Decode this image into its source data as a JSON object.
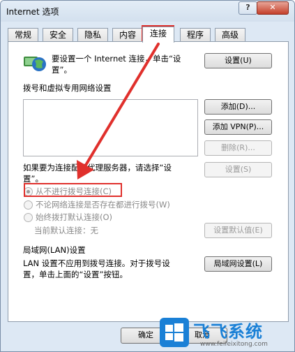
{
  "window": {
    "title": "Internet 选项",
    "help_label": "?",
    "close_label": "✕"
  },
  "tabs": [
    {
      "label": "常规"
    },
    {
      "label": "安全"
    },
    {
      "label": "隐私"
    },
    {
      "label": "内容"
    },
    {
      "label": "连接"
    },
    {
      "label": "程序"
    },
    {
      "label": "高级"
    }
  ],
  "setup": {
    "text_line1": "要设置一个 Internet 连接，单击“设",
    "text_line2": "置”。",
    "button": "设置(U)"
  },
  "dialup": {
    "group_label": "拨号和虚拟专用网络设置",
    "add_button": "添加(D)...",
    "add_vpn_button": "添加 VPN(P)...",
    "remove_button": "删除(R)...",
    "proxy_text_line1": "如果要为连接配置代理服务器，请选择“设",
    "proxy_text_line2": "置”。",
    "settings_button": "设置(S)",
    "radio_never": "从不进行拨号连接(C)",
    "radio_network": "不论网络连接是否存在都进行拨号(W)",
    "radio_always": "始终拨打默认连接(O)",
    "current_default": "当前默认连接：无",
    "set_default_button": "设置默认值(E)"
  },
  "lan": {
    "group_label": "局域网(LAN)设置",
    "text_line1": "LAN 设置不应用到拨号连接。对于拨号设",
    "text_line2": "置，单击上面的“设置”按钮。",
    "button": "局域网设置(L)"
  },
  "footer": {
    "ok": "确定",
    "cancel": "取消"
  },
  "watermark": {
    "title": "飞飞系统",
    "url": "www.feifeixitong.com"
  },
  "colors": {
    "highlight": "#e0302c",
    "watermark": "#1a80d6"
  }
}
